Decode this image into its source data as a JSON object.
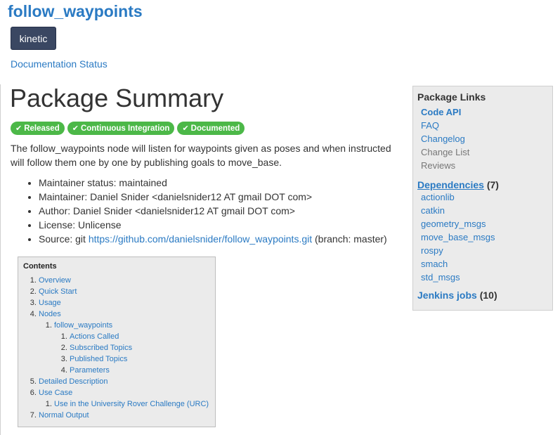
{
  "page": {
    "title": "follow_waypoints",
    "distro_button": "kinetic",
    "documentation_status": "Documentation Status"
  },
  "summary": {
    "heading": "Package Summary",
    "badges": [
      {
        "label": "Released",
        "icon": "check-icon"
      },
      {
        "label": "Continuous Integration",
        "icon": "check-icon"
      },
      {
        "label": "Documented",
        "icon": "check-icon"
      }
    ],
    "description": "The follow_waypoints node will listen for waypoints given as poses and when instructed will follow them one by one by publishing goals to move_base.",
    "maintainer_status": "Maintainer status: maintained",
    "maintainer": "Maintainer: Daniel Snider <danielsnider12 AT gmail DOT com>",
    "author": "Author: Daniel Snider <danielsnider12 AT gmail DOT com>",
    "license": "License: Unlicense",
    "source_prefix": "Source: git ",
    "source_url": "https://github.com/danielsnider/follow_waypoints.git",
    "source_suffix": " (branch: master)"
  },
  "contents": {
    "title": "Contents",
    "items": {
      "overview": "Overview",
      "quick_start": "Quick Start",
      "usage": "Usage",
      "nodes": "Nodes",
      "follow_waypoints": "follow_waypoints",
      "actions_called": "Actions Called",
      "subscribed_topics": "Subscribed Topics",
      "published_topics": "Published Topics",
      "parameters": "Parameters",
      "detailed_description": "Detailed Description",
      "use_case": "Use Case",
      "urc": "Use in the University Rover Challenge (URC)",
      "normal_output": "Normal Output"
    }
  },
  "sidebar": {
    "links_title": "Package Links",
    "links": [
      "Code API",
      "FAQ",
      "Changelog",
      "Change List",
      "Reviews"
    ],
    "dependencies_label": "Dependencies",
    "dependencies_count": "(7)",
    "dependencies": [
      "actionlib",
      "catkin",
      "geometry_msgs",
      "move_base_msgs",
      "rospy",
      "smach",
      "std_msgs"
    ],
    "jenkins_label": "Jenkins jobs",
    "jenkins_count": "(10)"
  },
  "colors": {
    "link": "#2a7ac3",
    "badge_green": "#4cb848",
    "distro_button": "#3a4762"
  }
}
